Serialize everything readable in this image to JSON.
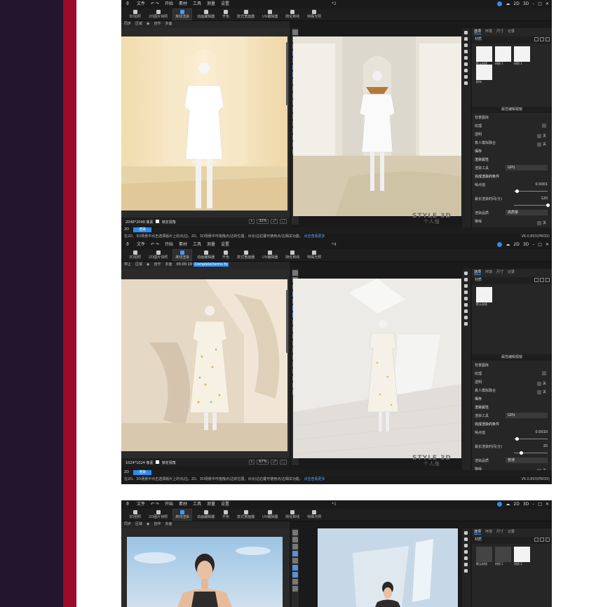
{
  "colors": {
    "accent": "#2d8cf0",
    "left_dark": "#22152d",
    "left_red": "#9c0b2a",
    "app_bg": "#1a1a1a"
  },
  "windows": [
    {
      "menu": [
        "文件",
        "开始",
        "素材",
        "工具",
        "测量",
        "设置"
      ],
      "tab_title": "*2",
      "right_icons": [
        "2D",
        "3D"
      ],
      "toolbar": [
        {
          "label": "3D拍照",
          "icon": "camera-icon"
        },
        {
          "label": "2D图片快照",
          "icon": "snapshot-icon"
        },
        {
          "label": "离线渲染",
          "icon": "render-icon",
          "active": true
        },
        {
          "label": "动画编辑器",
          "icon": "animation-icon"
        },
        {
          "label": "开色",
          "icon": "color-icon"
        },
        {
          "label": "款式宽面器",
          "icon": "style-icon"
        },
        {
          "label": "UV编辑器",
          "icon": "uv-icon"
        },
        {
          "label": "随化到线",
          "icon": "line-icon"
        },
        {
          "label": "特殊光照",
          "icon": "light-icon"
        }
      ],
      "subbar": [
        "同步",
        "区域",
        "",
        "自作",
        "多面"
      ],
      "timer": "",
      "timer_chip": "",
      "render_info": "2048*2048 像素",
      "lock_view": "锁定视角",
      "zoom": "32%",
      "brand": "STYLE 3D",
      "brand_sub": "个人版",
      "panel_tabs": [
        "选项",
        "环境",
        "尺寸",
        "记录"
      ],
      "panel_section": "材质",
      "thumbs": [
        {
          "label": "默认材质"
        },
        {
          "label": "材质 1"
        },
        {
          "label": "材质 1"
        },
        {
          "label": "帆布"
        }
      ],
      "prop_title": "属性编辑视窗",
      "props": [
        {
          "label": "背景图库",
          "type": "text"
        },
        {
          "label": "纹理",
          "type": "check"
        },
        {
          "label": "透明",
          "type": "check",
          "value": "关"
        },
        {
          "label": "真人模拟融合",
          "type": "check",
          "value": "关"
        },
        {
          "label": "保存",
          "type": "section"
        },
        {
          "label": "渲染属性",
          "type": "section"
        },
        {
          "label": "渲染工具",
          "type": "select",
          "value": "GPU"
        },
        {
          "label": "完成渲染的条件",
          "type": "section"
        },
        {
          "label": "噪点值",
          "type": "slider",
          "value": "0.0001",
          "pos": 0.05
        },
        {
          "label": "最长渲染时间(分)",
          "type": "slider",
          "value": "120",
          "pos": 0.96
        },
        {
          "label": "渲染品质",
          "type": "select",
          "value": "高质量"
        },
        {
          "label": "降噪",
          "type": "check",
          "value": "关"
        }
      ],
      "tab_2d": "2D",
      "tab_render": "渲染",
      "status": "在2D、3D场景中点击选择版片上的点/边。2D、3D场景中可拖拽点/边的位置。对点/边右键可使用点/边相关功能。",
      "status_link": "点击查看更多",
      "version": "V6.0.803(PROD)"
    },
    {
      "menu": [
        "文件",
        "开始",
        "素材",
        "工具",
        "测量",
        "设置"
      ],
      "tab_title": "*4",
      "right_icons": [
        "2D",
        "3D"
      ],
      "toolbar": [
        {
          "label": "3D拍照",
          "icon": "camera-icon"
        },
        {
          "label": "2D图片快照",
          "icon": "snapshot-icon"
        },
        {
          "label": "离线渲染",
          "icon": "render-icon",
          "active": true
        },
        {
          "label": "动画编辑器",
          "icon": "animation-icon"
        },
        {
          "label": "开色",
          "icon": "color-icon"
        },
        {
          "label": "款式宽面器",
          "icon": "style-icon"
        },
        {
          "label": "UV编辑器",
          "icon": "uv-icon"
        },
        {
          "label": "随化到线",
          "icon": "line-icon"
        },
        {
          "label": "特殊光照",
          "icon": "light-icon"
        }
      ],
      "subbar": [
        "停止",
        "区域",
        "",
        "自作",
        "多面"
      ],
      "timer": "00:00:19",
      "timer_chip": "Complete(terms fo",
      "render_info": "1024*1024 像素",
      "lock_view": "锁定视角",
      "zoom": "67%",
      "brand": "STYLE 3D",
      "brand_sub": "个人版",
      "panel_tabs": [
        "选项",
        "环境",
        "尺寸",
        "记录"
      ],
      "panel_section": "材质",
      "thumbs": [
        {
          "label": "默认材质"
        }
      ],
      "prop_title": "属性编辑视窗",
      "props": [
        {
          "label": "背景图库",
          "type": "text"
        },
        {
          "label": "纹理",
          "type": "check"
        },
        {
          "label": "透明",
          "type": "check",
          "value": "关"
        },
        {
          "label": "真人模拟融合",
          "type": "check",
          "value": "关"
        },
        {
          "label": "保存",
          "type": "section"
        },
        {
          "label": "渲染属性",
          "type": "section"
        },
        {
          "label": "渲染工具",
          "type": "select",
          "value": "GPU"
        },
        {
          "label": "完成渲染的条件",
          "type": "section"
        },
        {
          "label": "噪点值",
          "type": "slider",
          "value": "0.0010",
          "pos": 0.05
        },
        {
          "label": "最长渲染时间(分)",
          "type": "slider",
          "value": "20",
          "pos": 0.16
        },
        {
          "label": "渲染品质",
          "type": "select",
          "value": "普通"
        },
        {
          "label": "降噪",
          "type": "check",
          "value": "关"
        }
      ],
      "tab_2d": "2D",
      "tab_render": "渲染",
      "status": "在2D、3D场景中点击选择版片上的点/边。2D、3D场景中可拖拽点/边的位置。对点/边右键可使用点/边相关功能。",
      "status_link": "点击查看更多",
      "version": "V6.0.803(PROD)"
    },
    {
      "menu": [
        "文件",
        "开始",
        "素材",
        "工具",
        "测量",
        "设置"
      ],
      "tab_title": "*1",
      "right_icons": [
        "2D",
        "3D"
      ],
      "toolbar": [
        {
          "label": "3D拍照",
          "icon": "camera-icon"
        },
        {
          "label": "2D图片快照",
          "icon": "snapshot-icon"
        },
        {
          "label": "离线渲染",
          "icon": "render-icon",
          "active": true
        },
        {
          "label": "动画编辑器",
          "icon": "animation-icon"
        },
        {
          "label": "开色",
          "icon": "color-icon"
        },
        {
          "label": "款式宽面器",
          "icon": "style-icon"
        },
        {
          "label": "UV编辑器",
          "icon": "uv-icon"
        },
        {
          "label": "随化到线",
          "icon": "line-icon"
        },
        {
          "label": "特殊光照",
          "icon": "light-icon"
        }
      ],
      "subbar": [
        "同步",
        "区域",
        "",
        "自作",
        "多面"
      ],
      "panel_tabs": [
        "选项",
        "环境",
        "尺寸",
        "记录"
      ],
      "panel_section": "材质",
      "thumbs": [
        {
          "label": "默认材质",
          "dark": true
        },
        {
          "label": "材质 1",
          "dark": true
        },
        {
          "label": "材质 2"
        }
      ]
    }
  ]
}
